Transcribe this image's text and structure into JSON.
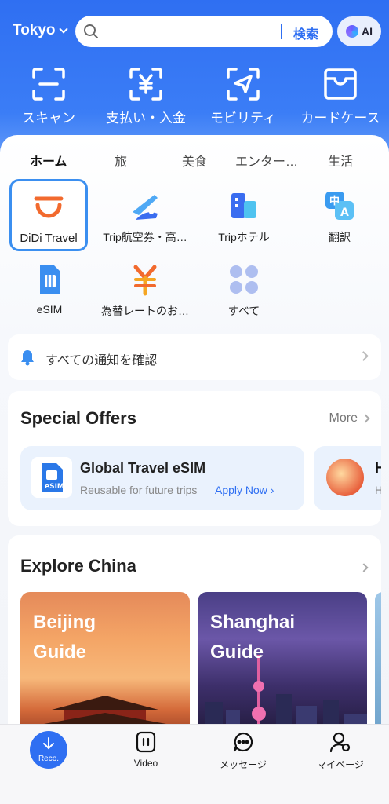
{
  "header": {
    "city": "Tokyo",
    "search_placeholder": "",
    "search_button": "検索",
    "ai_label": "AI"
  },
  "quick_actions": [
    {
      "label": "スキャン",
      "icon": "scan-icon"
    },
    {
      "label": "支払い・入金",
      "icon": "yen-payment-icon"
    },
    {
      "label": "モビリティ",
      "icon": "navigation-icon"
    },
    {
      "label": "カードケース",
      "icon": "wallet-icon"
    }
  ],
  "tabs": [
    {
      "label": "ホーム",
      "active": true
    },
    {
      "label": "旅"
    },
    {
      "label": "美食"
    },
    {
      "label": "エンター…"
    },
    {
      "label": "生活"
    }
  ],
  "services": [
    {
      "label": "DiDi Travel",
      "icon": "didi-icon",
      "selected": true
    },
    {
      "label": "Trip航空券・高…",
      "icon": "flight-icon"
    },
    {
      "label": "Tripホテル",
      "icon": "hotel-icon"
    },
    {
      "label": "翻訳",
      "icon": "translate-icon"
    },
    {
      "label": "eSIM",
      "icon": "esim-icon"
    },
    {
      "label": "為替レートのお…",
      "icon": "exchange-rate-icon"
    },
    {
      "label": "すべて",
      "icon": "all-apps-icon"
    }
  ],
  "notice": {
    "text": "すべての通知を確認"
  },
  "special_offers": {
    "title": "Special Offers",
    "more": "More",
    "cards": [
      {
        "title": "Global Travel eSIM",
        "subtitle": "Reusable for future trips",
        "link": "Apply Now"
      },
      {
        "title": "H",
        "subtitle": "H"
      }
    ]
  },
  "explore": {
    "title": "Explore China",
    "guides": [
      {
        "line1": "Beijing",
        "line2": "Guide"
      },
      {
        "line1": "Shanghai",
        "line2": "Guide"
      }
    ]
  },
  "bottom_nav": [
    {
      "label": "Reco.",
      "active": true
    },
    {
      "label": "Video"
    },
    {
      "label": "メッセージ"
    },
    {
      "label": "マイページ"
    }
  ],
  "colors": {
    "accent": "#2f6ff2",
    "hero_top": "#2f6ff2",
    "selected_border": "#3b8ff0",
    "didi_orange": "#f26a2e"
  }
}
